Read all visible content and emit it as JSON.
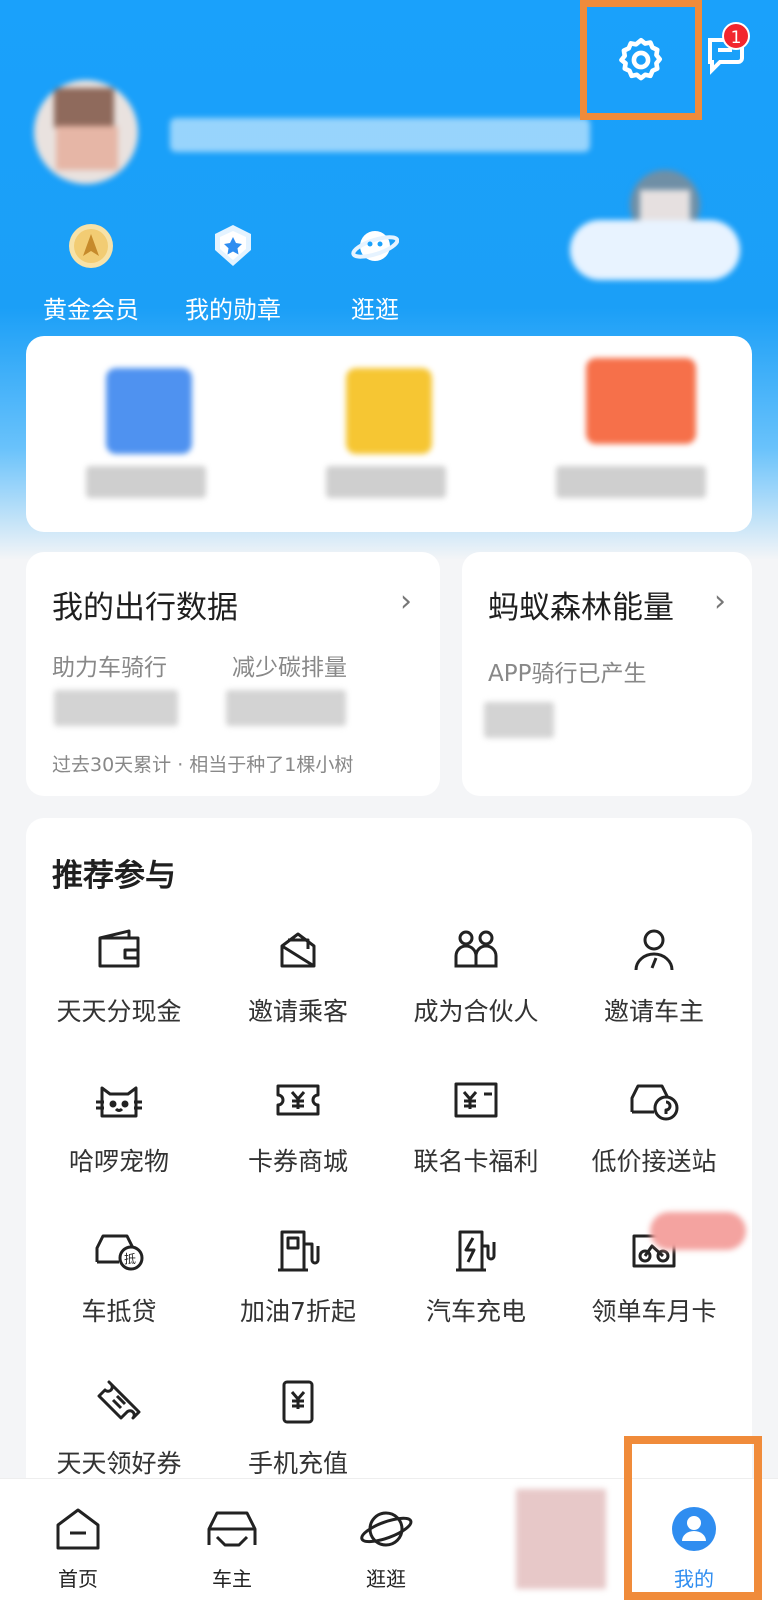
{
  "header": {
    "notification_count": "1",
    "shortcuts": [
      {
        "label": "黄金会员",
        "icon": "gold-member-icon"
      },
      {
        "label": "我的勋章",
        "icon": "medal-icon"
      },
      {
        "label": "逛逛",
        "icon": "planet-icon"
      }
    ]
  },
  "travel_data": {
    "title": "我的出行数据",
    "col1_label": "助力车骑行",
    "col2_label": "减少碳排量",
    "footnote": "过去30天累计 · 相当于种了1棵小树"
  },
  "forest": {
    "title": "蚂蚁森林能量",
    "subtitle": "APP骑行已产生"
  },
  "recommend": {
    "title": "推荐参与",
    "items": [
      {
        "label": "天天分现金",
        "icon": "wallet-icon"
      },
      {
        "label": "邀请乘客",
        "icon": "envelope-icon"
      },
      {
        "label": "成为合伙人",
        "icon": "partner-icon"
      },
      {
        "label": "邀请车主",
        "icon": "driver-icon"
      },
      {
        "label": "哈啰宠物",
        "icon": "cat-icon"
      },
      {
        "label": "卡券商城",
        "icon": "coupon-icon"
      },
      {
        "label": "联名卡福利",
        "icon": "card-icon"
      },
      {
        "label": "低价接送站",
        "icon": "car-station-icon"
      },
      {
        "label": "车抵贷",
        "icon": "car-loan-icon"
      },
      {
        "label": "加油7折起",
        "icon": "fuel-icon"
      },
      {
        "label": "汽车充电",
        "icon": "charging-icon"
      },
      {
        "label": "领单车月卡",
        "icon": "bike-card-icon"
      },
      {
        "label": "天天领好券",
        "icon": "ticket-icon"
      },
      {
        "label": "手机充值",
        "icon": "phone-topup-icon"
      }
    ]
  },
  "tabbar": {
    "tabs": [
      {
        "label": "首页",
        "icon": "home-icon"
      },
      {
        "label": "车主",
        "icon": "car-icon"
      },
      {
        "label": "逛逛",
        "icon": "planet-icon"
      },
      {
        "label": "我的",
        "icon": "profile-icon"
      }
    ],
    "active": "我的"
  },
  "colors": {
    "primary": "#1aa1fb",
    "highlight_box": "#f08b3a",
    "badge": "#f2262f"
  }
}
